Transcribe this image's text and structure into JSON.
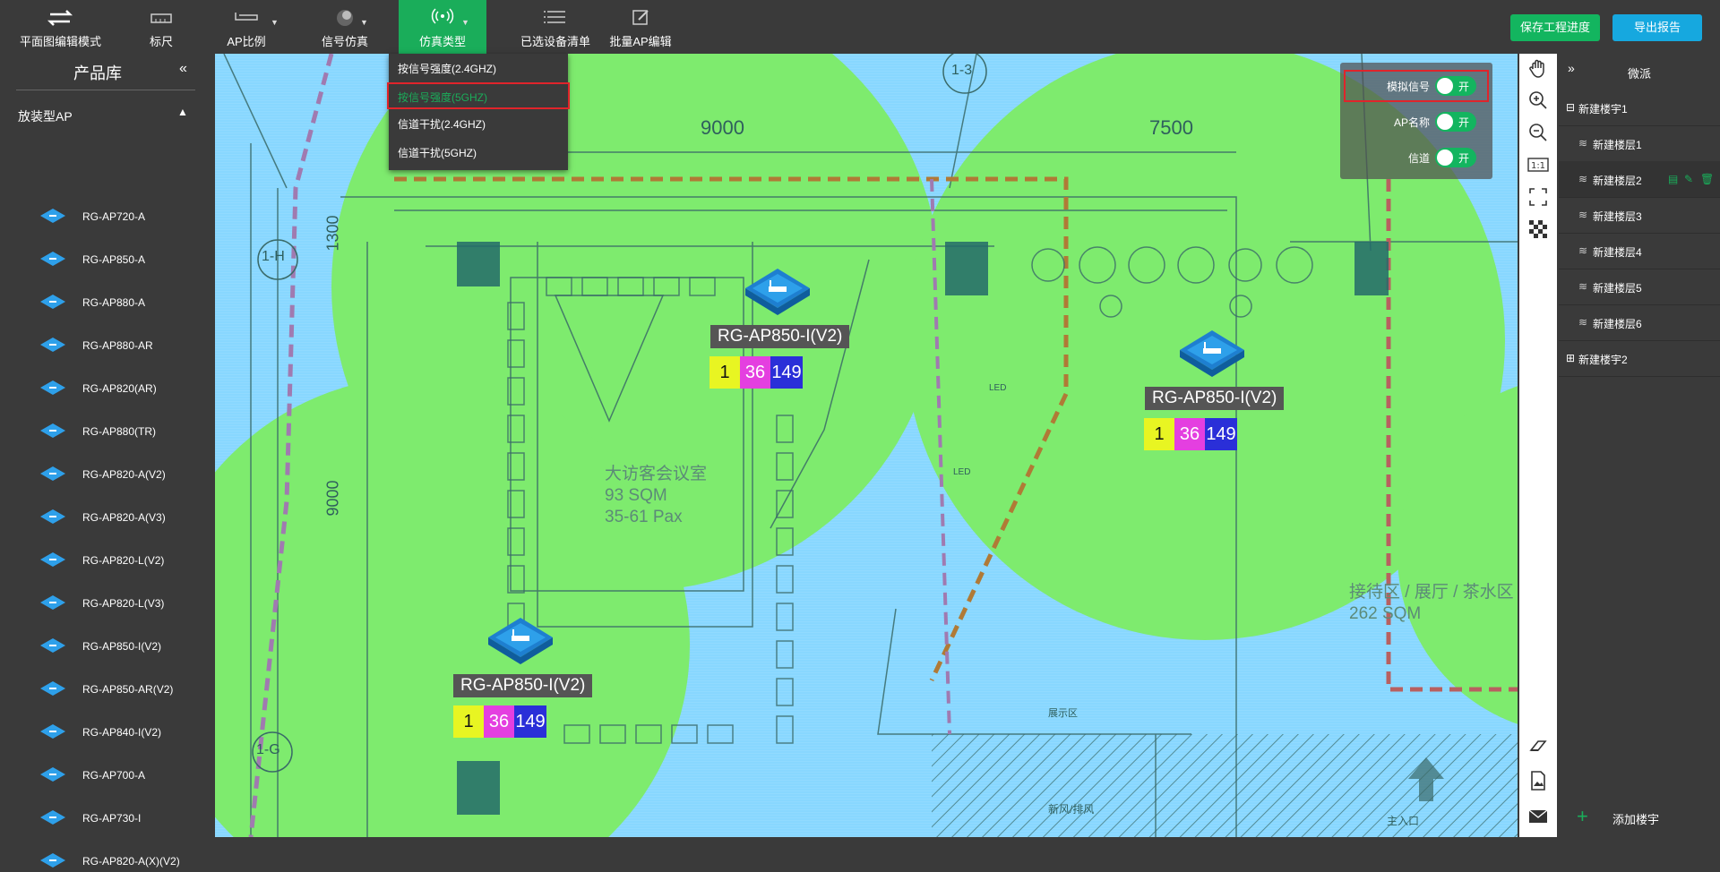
{
  "toolbar": {
    "items": [
      {
        "label": "平面图编辑模式",
        "icon": "swap-arrows-icon"
      },
      {
        "label": "标尺",
        "icon": "ruler-icon"
      },
      {
        "label": "AP比例",
        "icon": "router-icon"
      },
      {
        "label": "信号仿真",
        "icon": "signal-bulb-icon"
      },
      {
        "label": "仿真类型",
        "icon": "broadcast-icon"
      },
      {
        "label": "已选设备清单",
        "icon": "list-icon"
      },
      {
        "label": "批量AP编辑",
        "icon": "edit-icon"
      }
    ],
    "save_label": "保存工程进度",
    "export_label": "导出报告"
  },
  "sim_menu": {
    "items": [
      "按信号强度(2.4GHZ)",
      "按信号强度(5GHZ)",
      "信道干扰(2.4GHZ)",
      "信道干扰(5GHZ)"
    ],
    "selected": "按信号强度(5GHZ)"
  },
  "library": {
    "title": "产品库",
    "collapse_icon": "«",
    "category": "放装型AP",
    "products": [
      "RG-AP720-A",
      "RG-AP850-A",
      "RG-AP880-A",
      "RG-AP880-AR",
      "RG-AP820(AR)",
      "RG-AP880(TR)",
      "RG-AP820-A(V2)",
      "RG-AP820-A(V3)",
      "RG-AP820-L(V2)",
      "RG-AP820-L(V3)",
      "RG-AP850-I(V2)",
      "RG-AP850-AR(V2)",
      "RG-AP840-I(V2)",
      "RG-AP700-A",
      "RG-AP730-I",
      "RG-AP820-A(X)(V2)"
    ]
  },
  "overlay": {
    "rows": [
      {
        "label": "模拟信号",
        "toggle": "开"
      },
      {
        "label": "AP名称",
        "toggle": "开"
      },
      {
        "label": "信道",
        "toggle": "开"
      }
    ]
  },
  "floorplan": {
    "dim_9000_top": "9000",
    "dim_7500": "7500",
    "dim_1300": "1300",
    "dim_9000_left": "9000",
    "grid_1h": "1-H",
    "grid_1g": "1-G",
    "grid_13": "1-3",
    "room1_name": "大访客会议室",
    "room1_area": "93 SQM",
    "room1_pax": "35-61 Pax",
    "room2_name": "接待区 / 展厅 / 茶水区",
    "room2_area": "262 SQM",
    "led1": "LED",
    "led2": "LED",
    "exhibit": "展示区",
    "access": "新风/排风",
    "entrance": "主入口"
  },
  "aps": [
    {
      "name": "RG-AP850-I(V2)",
      "channels": [
        "1",
        "36",
        "149"
      ]
    },
    {
      "name": "RG-AP850-I(V2)",
      "channels": [
        "1",
        "36",
        "149"
      ]
    },
    {
      "name": "RG-AP850-I(V2)",
      "channels": [
        "1",
        "36",
        "149"
      ]
    }
  ],
  "channel_colors": [
    "#e8f522",
    "#e43fe0",
    "#2a2fd8"
  ],
  "buildings": {
    "title": "微派",
    "expand_icon": "»",
    "b1": "新建楼宇1",
    "floors": [
      "新建楼层1",
      "新建楼层2",
      "新建楼层3",
      "新建楼层4",
      "新建楼层5",
      "新建楼层6"
    ],
    "b2": "新建楼宇2",
    "add_label": "添加楼宇"
  },
  "colors": {
    "accent": "#1aad5a",
    "export": "#16a8df",
    "highlight": "#e0242b"
  }
}
